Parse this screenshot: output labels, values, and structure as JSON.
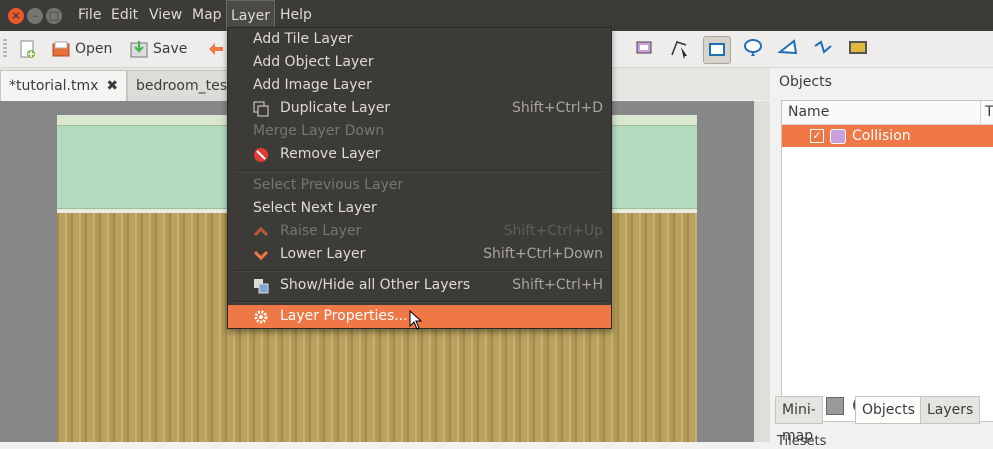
{
  "menubar": {
    "items": [
      "File",
      "Edit",
      "View",
      "Map",
      "Layer",
      "Help"
    ],
    "active": "Layer"
  },
  "toolbar": {
    "open_label": "Open",
    "save_label": "Save"
  },
  "tabs": [
    {
      "label": "*tutorial.tmx",
      "close": "✖"
    },
    {
      "label": "bedroom_test",
      "close": ""
    }
  ],
  "objects_panel": {
    "title": "Objects",
    "col_name": "Name",
    "col_type": "T",
    "rows": [
      {
        "name": "Collision",
        "checked": true
      }
    ]
  },
  "bottom_tabs": [
    "Mini-map",
    "Objects",
    "Layers"
  ],
  "tilesets_label": "Tilesets",
  "layer_menu": {
    "items": [
      {
        "label": "Add Tile Layer",
        "shortcut": "",
        "enabled": true
      },
      {
        "label": "Add Object Layer",
        "shortcut": "",
        "enabled": true
      },
      {
        "label": "Add Image Layer",
        "shortcut": "",
        "enabled": true
      },
      {
        "label": "Duplicate Layer",
        "shortcut": "Shift+Ctrl+D",
        "enabled": true,
        "icon": "duplicate-icon"
      },
      {
        "label": "Merge Layer Down",
        "shortcut": "",
        "enabled": false
      },
      {
        "label": "Remove Layer",
        "shortcut": "",
        "enabled": true,
        "icon": "remove-icon"
      },
      {
        "label": "Select Previous Layer",
        "shortcut": "",
        "enabled": false
      },
      {
        "label": "Select Next Layer",
        "shortcut": "",
        "enabled": true
      },
      {
        "label": "Raise Layer",
        "shortcut": "Shift+Ctrl+Up",
        "enabled": false,
        "icon": "raise-icon"
      },
      {
        "label": "Lower Layer",
        "shortcut": "Shift+Ctrl+Down",
        "enabled": true,
        "icon": "lower-icon"
      },
      {
        "label": "Show/Hide all Other Layers",
        "shortcut": "Shift+Ctrl+H",
        "enabled": true,
        "icon": "show-hide-icon"
      },
      {
        "label": "Layer Properties...",
        "shortcut": "",
        "enabled": true,
        "highlighted": true,
        "icon": "gear-icon"
      }
    ]
  }
}
